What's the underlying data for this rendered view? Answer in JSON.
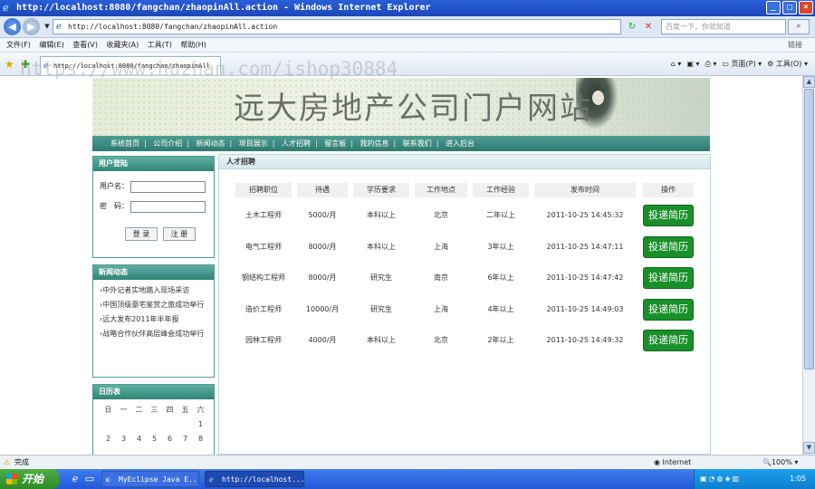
{
  "window": {
    "title": "http://localhost:8080/fangchan/zhaopinAll.action - Windows Internet Explorer",
    "controls": [
      "_",
      "□",
      "×"
    ]
  },
  "address": {
    "url": "http://localhost:8080/fangchan/zhaopinAll.action",
    "search_placeholder": "百度一下，你就知道"
  },
  "menu": {
    "items": [
      "文件(F)",
      "编辑(E)",
      "查看(V)",
      "收藏夹(A)",
      "工具(T)",
      "帮助(H)"
    ],
    "right": "链接"
  },
  "tab": {
    "label": "http://localhost:8080/fangchan/zhaopinAll"
  },
  "commandbar": {
    "page": "页面(P)",
    "tools": "工具(O)"
  },
  "watermark": "https://www.huzhan.com/ishop30884",
  "site": {
    "title": "远大房地产公司门户网站",
    "nav": [
      "系统首页",
      "公司介绍",
      "新闻动态",
      "项目展示",
      "人才招聘",
      "留言板",
      "我的信息",
      "联系我们",
      "进入后台"
    ]
  },
  "login": {
    "heading": "用户登陆",
    "username_label": "用户名：",
    "password_label": "密　码：",
    "login_button": "登 录",
    "register_button": "注 册"
  },
  "news": {
    "heading": "新闻动态",
    "items": [
      "中外记者实地踏入现场采访",
      "中国顶级豪宅鉴赏之旅成功举行",
      "远大发布2011年半年报",
      "战略合作伙伴高层峰会成功举行"
    ]
  },
  "calendar": {
    "heading": "日历表",
    "weekdays": [
      "日",
      "一",
      "二",
      "三",
      "四",
      "五",
      "六"
    ],
    "days": [
      "",
      "",
      "",
      "",
      "",
      "",
      "1",
      "2",
      "3",
      "4",
      "5",
      "6",
      "7",
      "8"
    ]
  },
  "jobs": {
    "heading": "人才招聘",
    "columns": [
      "招聘职位",
      "待遇",
      "学历要求",
      "工作地点",
      "工作经验",
      "发布时间",
      "操作"
    ],
    "rows": [
      [
        "土木工程师",
        "5000/月",
        "本科以上",
        "北京",
        "二年以上",
        "2011-10-25 14:45:32"
      ],
      [
        "电气工程师",
        "8000/月",
        "本科以上",
        "上海",
        "3年以上",
        "2011-10-25 14:47:11"
      ],
      [
        "钢结构工程师",
        "8000/月",
        "研究生",
        "南京",
        "6年以上",
        "2011-10-25 14:47:42"
      ],
      [
        "造价工程师",
        "10000/月",
        "研究生",
        "上海",
        "4年以上",
        "2011-10-25 14:49:03"
      ],
      [
        "园林工程师",
        "4000/月",
        "本科以上",
        "北京",
        "2年以上",
        "2011-10-25 14:49:32"
      ]
    ],
    "action_label": "投递简历"
  },
  "status": {
    "text": "完成",
    "zone": "Internet",
    "zoom": "100%"
  },
  "taskbar": {
    "start": "开始",
    "tasks": [
      "MyEclipse Java E...",
      "http://localhost..."
    ],
    "clock": "1:05"
  }
}
